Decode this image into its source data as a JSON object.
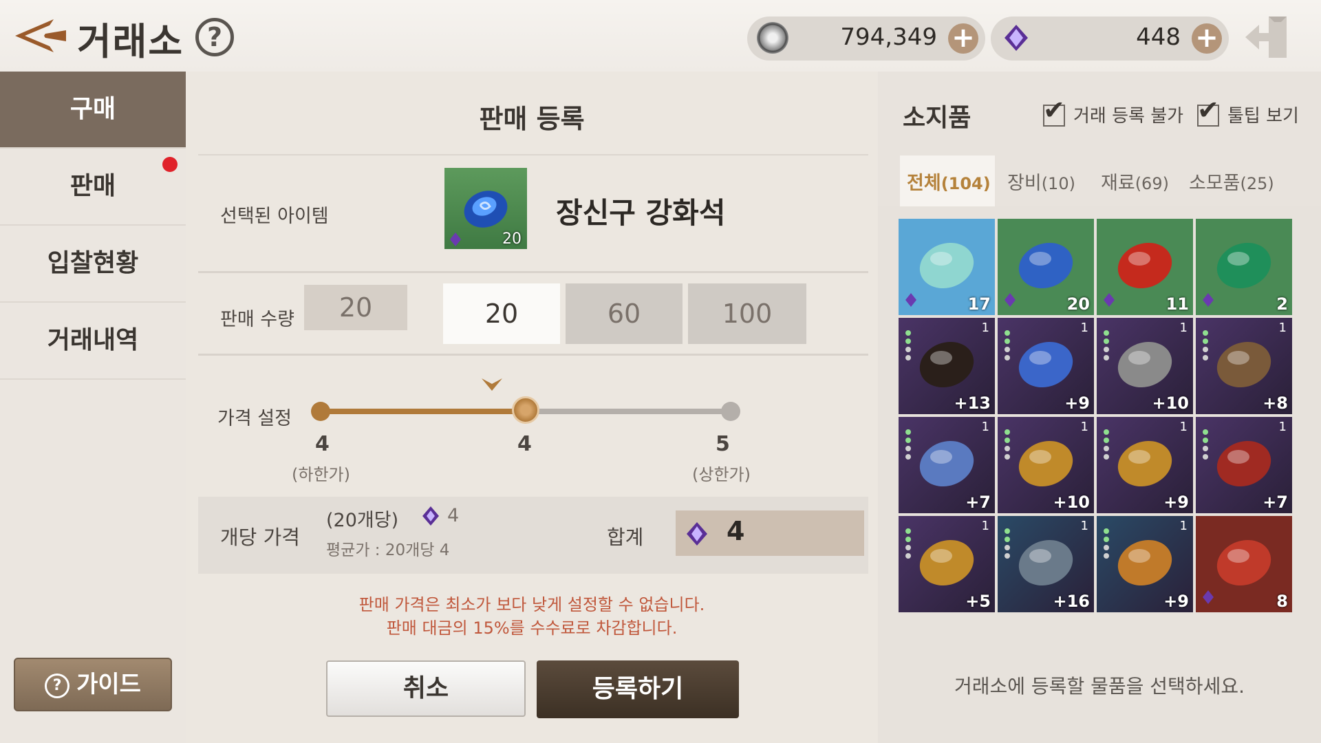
{
  "header": {
    "title": "거래소",
    "help_label": "?",
    "silver_amount": "794,349",
    "gem_amount": "448",
    "plus_label": "+"
  },
  "nav": {
    "items": [
      {
        "label": "구매",
        "active": true
      },
      {
        "label": "판매",
        "active": false
      },
      {
        "label": "입찰현황",
        "active": false
      },
      {
        "label": "거래내역",
        "active": false
      }
    ],
    "guide_label": "가이드",
    "guide_icon_label": "?"
  },
  "sale": {
    "title": "판매 등록",
    "selected_item_label": "선택된 아이템",
    "item_name": "장신구 강화석",
    "item_count": "20",
    "qty_label": "판매 수량",
    "qty_input": "20",
    "qty_options": [
      "20",
      "60",
      "100"
    ],
    "qty_selected": "20",
    "price_label": "가격 설정",
    "price_min": "4",
    "price_min_label": "(하한가)",
    "price_current": "4",
    "price_max": "5",
    "price_max_label": "(상한가)",
    "slider_fraction": 0.5,
    "unit_price_label": "개당 가격",
    "unit_qty": "(20개당)",
    "unit_value": "4",
    "avg_price": "평균가 : 20개당 4",
    "total_label": "합계",
    "total_value": "4",
    "notice_lines": [
      "판매 가격은 최소가 보다 낮게 설정할 수 없습니다.",
      "판매 대금의 15%를 수수료로 차감합니다."
    ],
    "cancel_label": "취소",
    "register_label": "등록하기"
  },
  "inventory": {
    "title": "소지품",
    "check_untradable": "거래 등록 불가",
    "check_tooltip": "툴팁 보기",
    "tabs": [
      {
        "label": "전체",
        "count": "(104)",
        "active": true
      },
      {
        "label": "장비",
        "count": "(10)",
        "active": false
      },
      {
        "label": "재료",
        "count": "(69)",
        "active": false
      },
      {
        "label": "소모품",
        "count": "(25)",
        "active": false
      }
    ],
    "items": [
      {
        "name": "scroll-item",
        "bg": "#5aa7d6",
        "label": "17",
        "kind": "count",
        "color": "#8fd6d0"
      },
      {
        "name": "blue-stone-item",
        "bg": "#4a8a55",
        "label": "20",
        "kind": "count",
        "color": "#2f62c4"
      },
      {
        "name": "red-stone-item",
        "bg": "#4a8a55",
        "label": "11",
        "kind": "count",
        "color": "#c52a1d"
      },
      {
        "name": "green-stone-item",
        "bg": "#4a8a55",
        "label": "2",
        "kind": "count",
        "color": "#1f8f5a"
      },
      {
        "name": "dark-feather-item",
        "bg": "#4a3466",
        "label": "+13",
        "kind": "enh",
        "color": "#2a1f1a"
      },
      {
        "name": "blue-ring-item",
        "bg": "#4a3466",
        "label": "+9",
        "kind": "enh",
        "color": "#3b66c9"
      },
      {
        "name": "silver-ring-item",
        "bg": "#4a3466",
        "label": "+10",
        "kind": "enh",
        "color": "#8a8a8a"
      },
      {
        "name": "ornate-ring-item",
        "bg": "#4a3466",
        "label": "+8",
        "kind": "enh",
        "color": "#7a5a3a"
      },
      {
        "name": "bracelet-item",
        "bg": "#4a3466",
        "label": "+7",
        "kind": "enh",
        "color": "#5a7ac0"
      },
      {
        "name": "necklace-item",
        "bg": "#4a3466",
        "label": "+10",
        "kind": "enh",
        "color": "#c08a2a"
      },
      {
        "name": "earring-item",
        "bg": "#4a3466",
        "label": "+9",
        "kind": "enh",
        "color": "#c08a2a"
      },
      {
        "name": "red-belt-item",
        "bg": "#4a3466",
        "label": "+7",
        "kind": "enh",
        "color": "#a02a22"
      },
      {
        "name": "gold-earring-item",
        "bg": "#4a3466",
        "label": "+5",
        "kind": "enh",
        "color": "#c08a2a"
      },
      {
        "name": "sapphire-bracelet-item",
        "bg": "#2a4a66",
        "label": "+16",
        "kind": "enh",
        "color": "#6a7a8a"
      },
      {
        "name": "staff-item",
        "bg": "#2a4a66",
        "label": "+9",
        "kind": "enh",
        "color": "#c07a2a"
      },
      {
        "name": "red-box-item",
        "bg": "#7a2a22",
        "label": "8",
        "kind": "count",
        "color": "#c03a2a"
      }
    ],
    "hint": "거래소에 등록할 물품을 선택하세요."
  }
}
